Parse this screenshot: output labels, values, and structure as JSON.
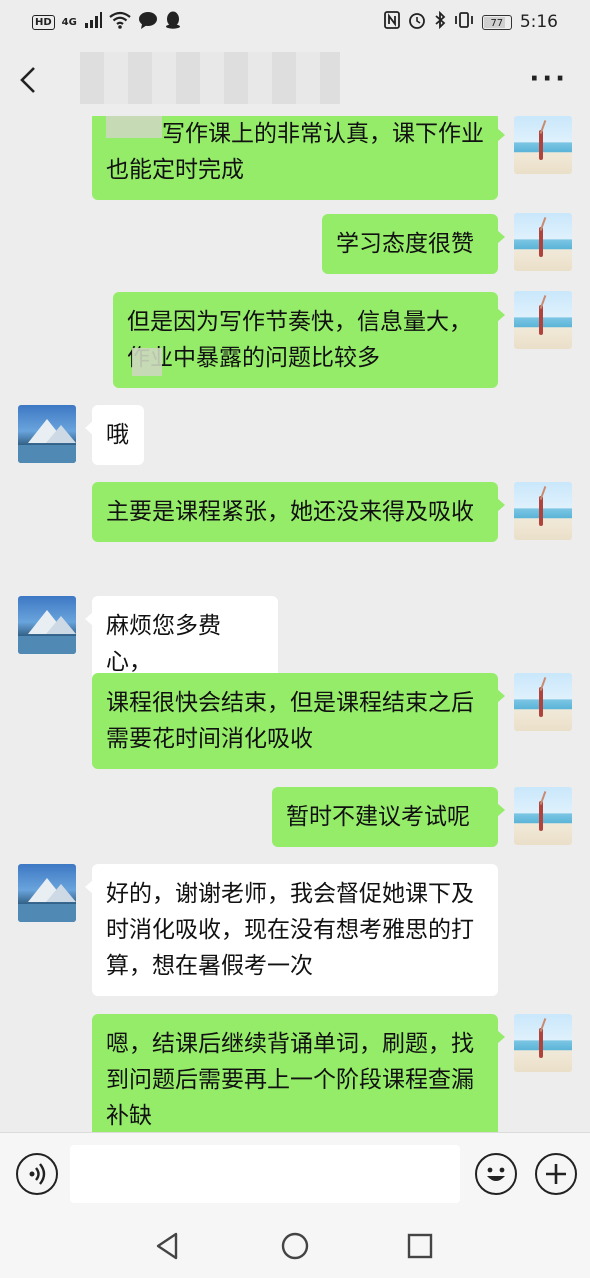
{
  "status_bar": {
    "left_badges": [
      "HD",
      "4G"
    ],
    "battery": "77",
    "time": "5:16"
  },
  "header": {
    "title": "",
    "back_icon": "chevron-left-icon",
    "more_icon": "more-icon"
  },
  "messages": [
    {
      "side": "out",
      "avatar": "beach",
      "text": "写作课上的非常认真，课下作业也能定时完成"
    },
    {
      "side": "out",
      "avatar": "beach",
      "text": "学习态度很赞"
    },
    {
      "side": "out",
      "avatar": "beach",
      "text": "但是因为写作节奏快，信息量大，作业中暴露的问题比较多"
    },
    {
      "side": "in",
      "avatar": "mountain",
      "text": "哦"
    },
    {
      "side": "out",
      "avatar": "beach",
      "text": "主要是课程紧张，她还没来得及吸收"
    },
    {
      "side": "in",
      "avatar": "mountain",
      "text": "麻烦您多费心，"
    },
    {
      "side": "out",
      "avatar": "beach",
      "text": "课程很快会结束，但是课程结束之后需要花时间消化吸收"
    },
    {
      "side": "out",
      "avatar": "beach",
      "text": "暂时不建议考试呢"
    },
    {
      "side": "in",
      "avatar": "mountain",
      "text": "好的，谢谢老师，我会督促她课下及时消化吸收，现在没有想考雅思的打算，想在暑假考一次"
    },
    {
      "side": "out",
      "avatar": "beach",
      "text": "嗯，结课后继续背诵单词，刷题，找到问题后需要再上一个阶段课程查漏补缺"
    }
  ],
  "input_bar": {
    "voice_icon": "voice-icon",
    "text_value": "",
    "emoji_icon": "emoji-icon",
    "plus_icon": "plus-icon"
  },
  "nav_bar": {
    "back": "triangle-back-icon",
    "home": "circle-home-icon",
    "recents": "square-recents-icon"
  },
  "colors": {
    "outgoing_bubble": "#95ec69",
    "incoming_bubble": "#ffffff",
    "background": "#ededed"
  }
}
